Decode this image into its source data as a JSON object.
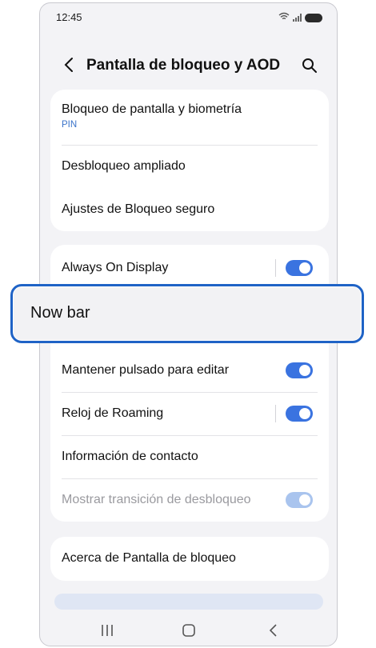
{
  "status_bar": {
    "time": "12:45"
  },
  "header": {
    "title": "Pantalla de bloqueo y AOD"
  },
  "group1": {
    "items": [
      {
        "label": "Bloqueo de pantalla y biometría",
        "sub": "PIN"
      },
      {
        "label": "Desbloqueo ampliado"
      },
      {
        "label": "Ajustes de Bloqueo seguro"
      }
    ]
  },
  "group2": {
    "always_on": {
      "label": "Always On Display",
      "enabled": true
    },
    "now_bar": {
      "label": "Now bar"
    },
    "items": [
      {
        "label": "Mantener pulsado para editar",
        "enabled": true
      },
      {
        "label": "Reloj de Roaming",
        "enabled": true
      },
      {
        "label": "Información de contacto"
      },
      {
        "label": "Mostrar transición de desbloqueo",
        "enabled": true,
        "disabled": true
      }
    ]
  },
  "group3": {
    "about": "Acerca de Pantalla de bloqueo"
  },
  "colors": {
    "accent": "#3a73e0",
    "highlight_border": "#1f63c6",
    "sub_text": "#3a73c9"
  }
}
